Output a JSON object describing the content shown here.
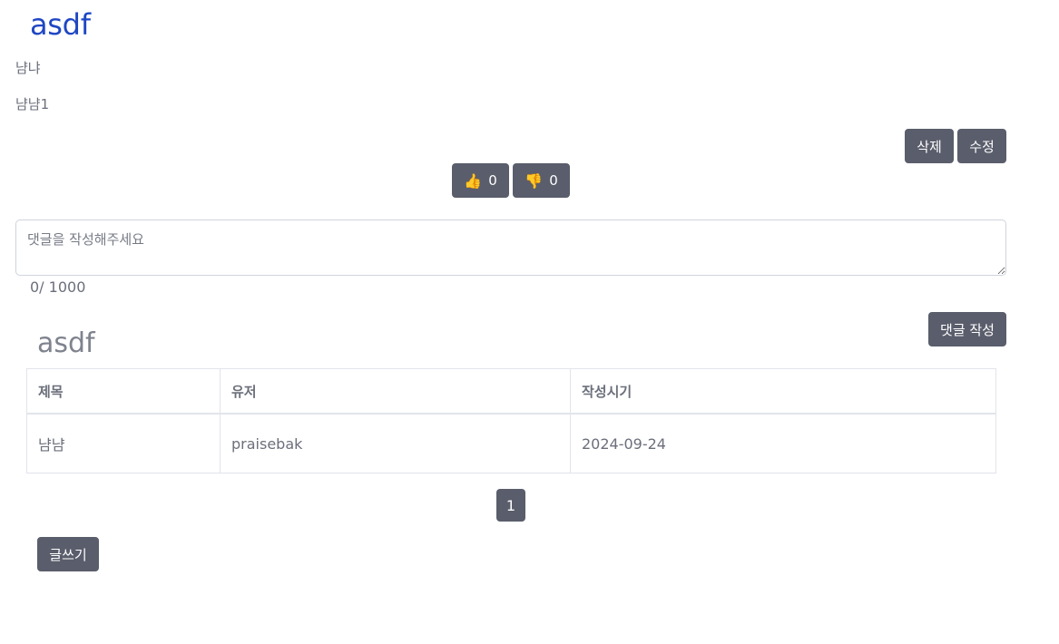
{
  "post": {
    "title": "asdf",
    "lines": [
      "냠냐",
      "냠냠1"
    ],
    "delete_label": "삭제",
    "edit_label": "수정"
  },
  "votes": {
    "like_icon": "👍",
    "like_count": "0",
    "dislike_icon": "👎",
    "dislike_count": "0"
  },
  "comment": {
    "placeholder": "댓글을 작성해주세요",
    "value": "",
    "counter": "0/ 1000",
    "submit_label": "댓글 작성"
  },
  "board": {
    "title": "asdf",
    "columns": [
      "제목",
      "유저",
      "작성시기"
    ],
    "rows": [
      [
        "냠냠",
        "praisebak",
        "2024-09-24"
      ]
    ]
  },
  "pagination": {
    "current": "1"
  },
  "write_label": "글쓰기"
}
